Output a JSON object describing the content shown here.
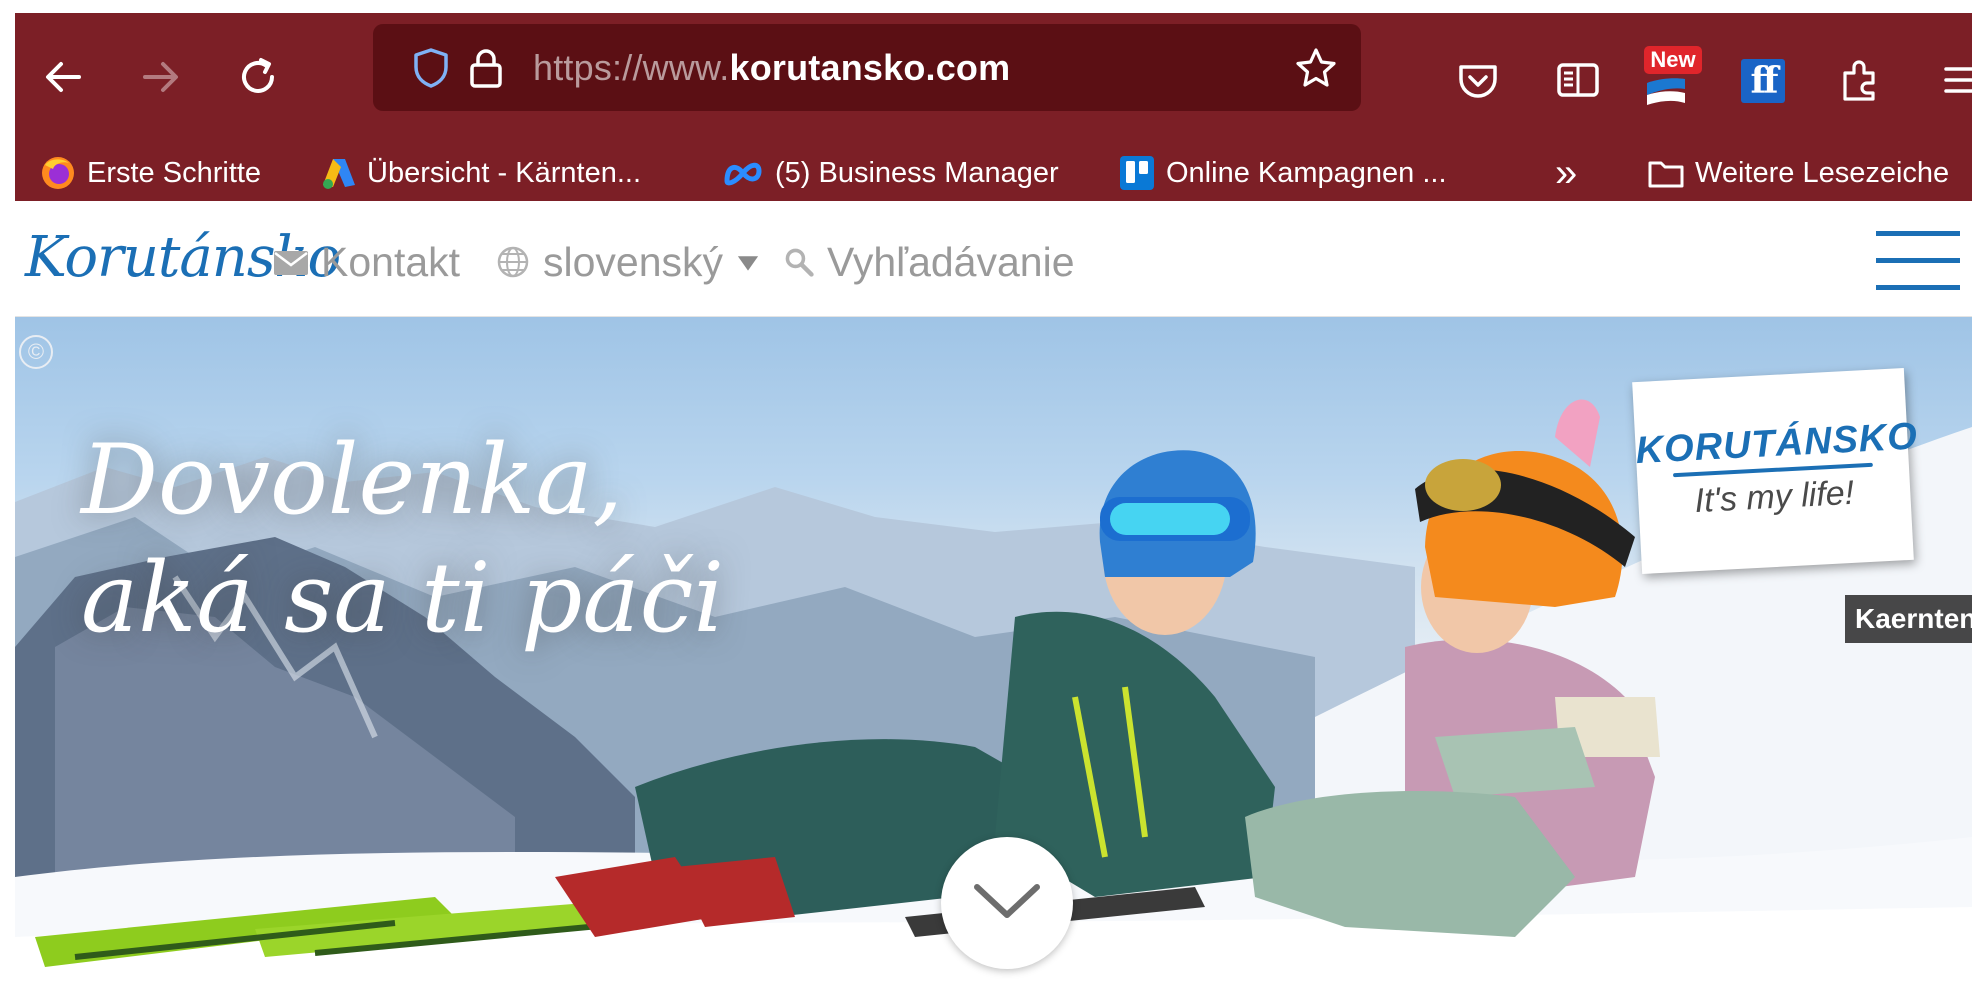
{
  "browser": {
    "url_prefix": "https://www.",
    "url_host": "korutansko.com",
    "new_badge": "New",
    "ff_label": "ff",
    "bookmarks": [
      {
        "label": "Erste Schritte",
        "icon": "firefox-icon"
      },
      {
        "label": "Übersicht - Kärnten...",
        "icon": "google-ads-icon"
      },
      {
        "label": "(5) Business Manager",
        "icon": "meta-icon"
      },
      {
        "label": "Online Kampagnen ...",
        "icon": "trello-icon"
      }
    ],
    "overflow_label": "»",
    "other_bookmarks": "Weitere Lesezeiche",
    "colors": {
      "chrome": "#7c1f26",
      "urlbar": "#5b0f14"
    }
  },
  "site": {
    "brand": "Korutánsko",
    "contact": "Kontakt",
    "language": "slovenský",
    "search": "Vyhľadávanie",
    "accent": "#1b6fb5"
  },
  "hero": {
    "copyright": "©",
    "title_line1": "Dovolenka,",
    "title_line2": "aká sa ti páči",
    "badge_title": "KORUTÁNSKO",
    "badge_subtitle": "It's my life!",
    "photo_credit": "Kaernten"
  }
}
